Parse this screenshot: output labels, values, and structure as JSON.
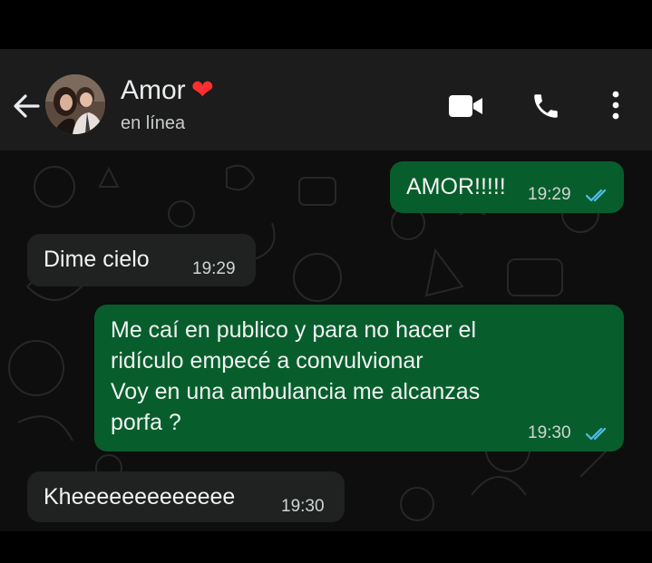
{
  "contact": {
    "name": "Amor",
    "heart": "❤",
    "status": "en línea"
  },
  "icons": {
    "back": "arrow-left-icon",
    "video": "video-camera-icon",
    "call": "phone-icon",
    "menu": "more-vertical-icon",
    "read": "double-check-icon"
  },
  "colors": {
    "header_bg": "#1b1c1b",
    "chat_bg": "#0d0e0d",
    "outgoing_bubble": "#075e2c",
    "incoming_bubble": "#1f2220",
    "read_ticks": "#53bdeb"
  },
  "messages": [
    {
      "direction": "out",
      "text": "AMOR!!!!!",
      "time": "19:29",
      "read": true
    },
    {
      "direction": "in",
      "text": "Dime cielo",
      "time": "19:29"
    },
    {
      "direction": "out",
      "lines": [
        "Me caí en publico y para no hacer el",
        "ridículo empecé a convulvionar",
        "Voy en una ambulancia me alcanzas",
        "porfa ?"
      ],
      "time": "19:30",
      "read": true
    },
    {
      "direction": "in",
      "text": "Kheeeeeeeeeeeee",
      "time": "19:30"
    }
  ]
}
